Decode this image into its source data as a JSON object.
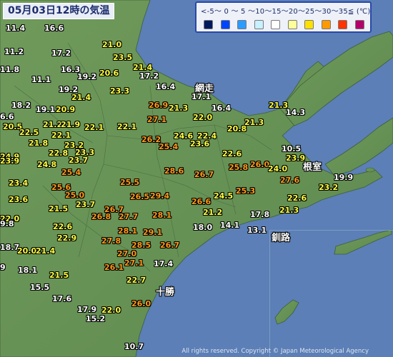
{
  "title": "05月03日12時の気温",
  "legend": {
    "text": "<-5～ 0 ～ 5 ～10～15～20～25～30～35≦ (℃)",
    "colors": [
      "#001a5c",
      "#0044ff",
      "#2b9cff",
      "#c8f0ff",
      "#ffffff",
      "#ffff99",
      "#ffe000",
      "#ff9900",
      "#ff3300",
      "#b4006a"
    ]
  },
  "places": {
    "abashiri": "網走",
    "nemuro": "根室",
    "kushiro": "釧路",
    "tokachi": "十勝"
  },
  "copyright": "All rights reserved. Copyright © Japan Meteorological Agency",
  "temps": [
    {
      "v": "11.4",
      "c": "wh"
    },
    {
      "v": "16.6",
      "c": "wh"
    },
    {
      "v": "21.0",
      "c": "ye"
    },
    {
      "v": "11.2",
      "c": "wh"
    },
    {
      "v": "17.2",
      "c": "wh"
    },
    {
      "v": "23.5",
      "c": "ye"
    },
    {
      "v": "11.8",
      "c": "wh"
    },
    {
      "v": "16.3",
      "c": "wh"
    },
    {
      "v": "20.6",
      "c": "ye"
    },
    {
      "v": "21.4",
      "c": "ye"
    },
    {
      "v": "19.2",
      "c": "wh"
    },
    {
      "v": "17.2",
      "c": "wh"
    },
    {
      "v": "11.1",
      "c": "wh"
    },
    {
      "v": "19.2",
      "c": "wh"
    },
    {
      "v": "23.3",
      "c": "ye"
    },
    {
      "v": "16.4",
      "c": "wh"
    },
    {
      "v": "21.4",
      "c": "ye"
    },
    {
      "v": "17.1",
      "c": "wh"
    },
    {
      "v": "21.3",
      "c": "ye"
    },
    {
      "v": "14.3",
      "c": "wh"
    },
    {
      "v": "18.2",
      "c": "wh"
    },
    {
      "v": "19.1",
      "c": "wh"
    },
    {
      "v": "20.9",
      "c": "ye"
    },
    {
      "v": "26.9",
      "c": "or"
    },
    {
      "v": "21.3",
      "c": "ye"
    },
    {
      "v": "16.4",
      "c": "wh"
    },
    {
      "v": "6.6",
      "c": "wh"
    },
    {
      "v": "22.0",
      "c": "ye"
    },
    {
      "v": "21.2",
      "c": "ye"
    },
    {
      "v": "21.9",
      "c": "ye"
    },
    {
      "v": "20.5",
      "c": "ye"
    },
    {
      "v": "22.1",
      "c": "ye"
    },
    {
      "v": "22.1",
      "c": "ye"
    },
    {
      "v": "27.1",
      "c": "or"
    },
    {
      "v": "21.3",
      "c": "ye"
    },
    {
      "v": "20.8",
      "c": "ye"
    },
    {
      "v": "22.5",
      "c": "ye"
    },
    {
      "v": "22.1",
      "c": "ye"
    },
    {
      "v": "24.6",
      "c": "ye"
    },
    {
      "v": "22.4",
      "c": "ye"
    },
    {
      "v": "21.8",
      "c": "ye"
    },
    {
      "v": "23.2",
      "c": "ye"
    },
    {
      "v": "26.2",
      "c": "or"
    },
    {
      "v": "25.4",
      "c": "or"
    },
    {
      "v": "23.6",
      "c": "ye"
    },
    {
      "v": "10.5",
      "c": "wh"
    },
    {
      "v": "24.9",
      "c": "ye"
    },
    {
      "v": "22.8",
      "c": "ye"
    },
    {
      "v": "23.3",
      "c": "ye"
    },
    {
      "v": "22.6",
      "c": "ye"
    },
    {
      "v": "23.9",
      "c": "ye"
    },
    {
      "v": "23.9",
      "c": "ye"
    },
    {
      "v": "24.8",
      "c": "ye"
    },
    {
      "v": "23.7",
      "c": "ye"
    },
    {
      "v": "25.8",
      "c": "or"
    },
    {
      "v": "26.0",
      "c": "or"
    },
    {
      "v": "24.0",
      "c": "ye"
    },
    {
      "v": "25.4",
      "c": "or"
    },
    {
      "v": "28.6",
      "c": "or"
    },
    {
      "v": "26.7",
      "c": "or"
    },
    {
      "v": "19.9",
      "c": "wh"
    },
    {
      "v": "23.4",
      "c": "ye"
    },
    {
      "v": "25.5",
      "c": "or"
    },
    {
      "v": "27.6",
      "c": "or"
    },
    {
      "v": "23.2",
      "c": "ye"
    },
    {
      "v": "25.6",
      "c": "or"
    },
    {
      "v": "25.3",
      "c": "or"
    },
    {
      "v": "23.6",
      "c": "ye"
    },
    {
      "v": "25.0",
      "c": "or"
    },
    {
      "v": "26.5",
      "c": "or"
    },
    {
      "v": "29.4",
      "c": "or"
    },
    {
      "v": "24.5",
      "c": "ye"
    },
    {
      "v": "26.6",
      "c": "or"
    },
    {
      "v": "22.6",
      "c": "ye"
    },
    {
      "v": "21.5",
      "c": "ye"
    },
    {
      "v": "23.7",
      "c": "ye"
    },
    {
      "v": "26.7",
      "c": "or"
    },
    {
      "v": "21.3",
      "c": "ye"
    },
    {
      "v": "22.0",
      "c": "ye"
    },
    {
      "v": "26.8",
      "c": "or"
    },
    {
      "v": "27.7",
      "c": "or"
    },
    {
      "v": "28.1",
      "c": "or"
    },
    {
      "v": "21.2",
      "c": "ye"
    },
    {
      "v": "17.8",
      "c": "wh"
    },
    {
      "v": "9.8",
      "c": "wh"
    },
    {
      "v": "22.6",
      "c": "ye"
    },
    {
      "v": "28.1",
      "c": "or"
    },
    {
      "v": "29.1",
      "c": "or"
    },
    {
      "v": "18.0",
      "c": "wh"
    },
    {
      "v": "14.1",
      "c": "wh"
    },
    {
      "v": "13.1",
      "c": "wh"
    },
    {
      "v": "22.9",
      "c": "ye"
    },
    {
      "v": "27.8",
      "c": "or"
    },
    {
      "v": "28.5",
      "c": "or"
    },
    {
      "v": "26.7",
      "c": "or"
    },
    {
      "v": "18.7",
      "c": "wh"
    },
    {
      "v": "20.0",
      "c": "ye"
    },
    {
      "v": "21.4",
      "c": "ye"
    },
    {
      "v": "27.0",
      "c": "or"
    },
    {
      "v": "26.1",
      "c": "or"
    },
    {
      "v": "27.1",
      "c": "or"
    },
    {
      "v": "17.4",
      "c": "wh"
    },
    {
      "v": "9",
      "c": "wh"
    },
    {
      "v": "18.1",
      "c": "wh"
    },
    {
      "v": "21.5",
      "c": "ye"
    },
    {
      "v": "22.7",
      "c": "ye"
    },
    {
      "v": "15.5",
      "c": "wh"
    },
    {
      "v": "17.6",
      "c": "wh"
    },
    {
      "v": "26.0",
      "c": "or"
    },
    {
      "v": "17.9",
      "c": "wh"
    },
    {
      "v": "22.0",
      "c": "ye"
    },
    {
      "v": "15.2",
      "c": "wh"
    },
    {
      "v": "10.7",
      "c": "wh"
    }
  ]
}
